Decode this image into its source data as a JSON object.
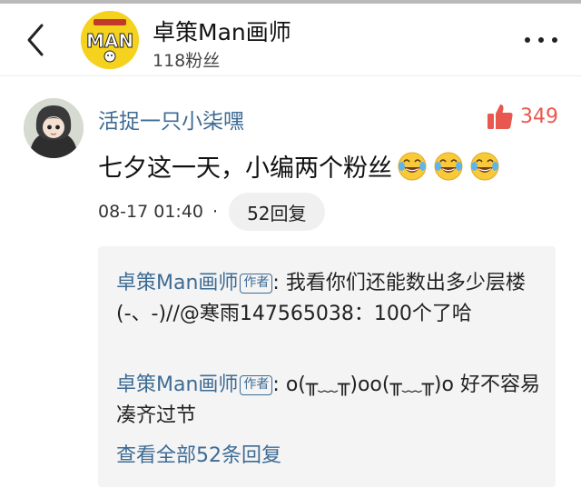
{
  "header": {
    "title": "卓策Man画师",
    "followers": "118粉丝",
    "logo_text": "MAN",
    "icons": {
      "back": "chevron-left-icon",
      "more": "more-dots-icon"
    }
  },
  "comment": {
    "username": "活捉一只小柒嘿",
    "likes": "349",
    "text": "七夕这一天，小编两个粉丝",
    "emoji_count": 3,
    "emoji_name": "laugh-cry-emoji",
    "timestamp": "08-17 01:40",
    "separator": "·",
    "reply_count_label": "52回复"
  },
  "replies": {
    "items": [
      {
        "author": "卓策Man画师",
        "tag": "作者",
        "text": ": 我看你们还能数出多少层楼(-、-)//@寒雨147565038：100个了哈"
      },
      {
        "author": "卓策Man画师",
        "tag": "作者",
        "text": ": o(╥﹏╥)oo(╥﹏╥)o 好不容易凑齐过节"
      }
    ],
    "see_all": "查看全部52条回复"
  },
  "colors": {
    "link_blue": "#3d6b94",
    "like_red": "#e8584f",
    "reply_bg": "#f4f4f4",
    "logo_yellow": "#f5d21e"
  }
}
